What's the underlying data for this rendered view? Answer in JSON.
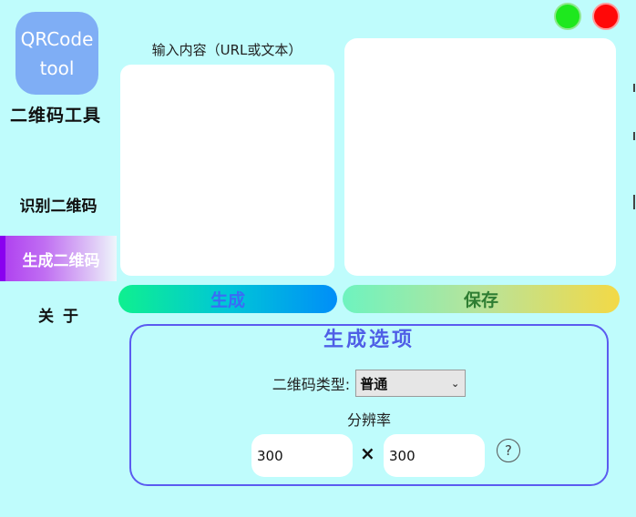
{
  "window": {
    "minimize_color": "#1ee81e",
    "close_color": "#ff0808"
  },
  "logo": {
    "line1": "QRCode",
    "line2": "tool"
  },
  "app_name": "二维码工具",
  "sidebar": {
    "items": [
      {
        "label": "识别二维码",
        "active": false
      },
      {
        "label": "生成二维码",
        "active": true
      },
      {
        "label": "关于",
        "active": false
      }
    ]
  },
  "input": {
    "label": "输入内容（URL或文本）",
    "value": ""
  },
  "actions": {
    "generate_label": "生成",
    "save_label": "保存"
  },
  "options": {
    "title": "生成选项",
    "type_label": "二维码类型:",
    "type_value": "普通",
    "resolution_label": "分辨率",
    "width": "300",
    "height": "300",
    "times": "×",
    "help": "?"
  },
  "colors": {
    "background": "#bffcfc",
    "accent": "#5b5bf0",
    "active_nav": "#8a00f0"
  }
}
